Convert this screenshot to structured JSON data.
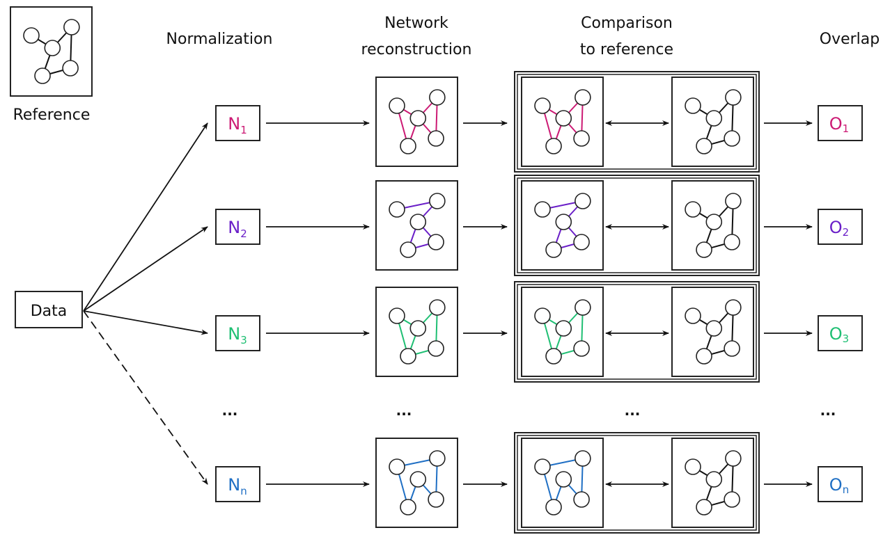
{
  "headers": {
    "normalization": "Normalization",
    "network_line1": "Network",
    "network_line2": "reconstruction",
    "comparison_line1": "Comparison",
    "comparison_line2": "to reference",
    "overlap": "Overlap"
  },
  "reference_label": "Reference",
  "data_label": "Data",
  "ellipsis": "...",
  "reference_network": {
    "nodes": [
      [
        0.18,
        0.27
      ],
      [
        0.83,
        0.15
      ],
      [
        0.52,
        0.45
      ],
      [
        0.36,
        0.85
      ],
      [
        0.81,
        0.74
      ]
    ],
    "edges": [
      [
        0,
        2
      ],
      [
        2,
        1
      ],
      [
        2,
        3
      ],
      [
        1,
        4
      ],
      [
        3,
        4
      ]
    ]
  },
  "rows": [
    {
      "id": "1",
      "color": "#cc1a74",
      "norm_letter": "N",
      "norm_sub": "1",
      "overlap_letter": "O",
      "overlap_sub": "1",
      "edges": [
        [
          0,
          2
        ],
        [
          0,
          3
        ],
        [
          3,
          2
        ],
        [
          2,
          1
        ],
        [
          1,
          4
        ],
        [
          2,
          4
        ]
      ],
      "source_line": "solid"
    },
    {
      "id": "2",
      "color": "#6a1fc8",
      "norm_letter": "N",
      "norm_sub": "2",
      "overlap_letter": "O",
      "overlap_sub": "2",
      "edges": [
        [
          0,
          1
        ],
        [
          1,
          2
        ],
        [
          2,
          3
        ],
        [
          2,
          4
        ],
        [
          3,
          4
        ]
      ],
      "source_line": "solid"
    },
    {
      "id": "3",
      "color": "#1fbf73",
      "norm_letter": "N",
      "norm_sub": "3",
      "overlap_letter": "O",
      "overlap_sub": "3",
      "edges": [
        [
          0,
          2
        ],
        [
          0,
          3
        ],
        [
          2,
          3
        ],
        [
          2,
          1
        ],
        [
          1,
          4
        ],
        [
          3,
          4
        ]
      ],
      "source_line": "solid"
    },
    {
      "id": "n",
      "color": "#1f6fc4",
      "norm_letter": "N",
      "norm_sub": "n",
      "overlap_letter": "O",
      "overlap_sub": "n",
      "edges": [
        [
          0,
          1
        ],
        [
          0,
          3
        ],
        [
          3,
          2
        ],
        [
          2,
          4
        ],
        [
          1,
          4
        ]
      ],
      "source_line": "dashed"
    }
  ]
}
